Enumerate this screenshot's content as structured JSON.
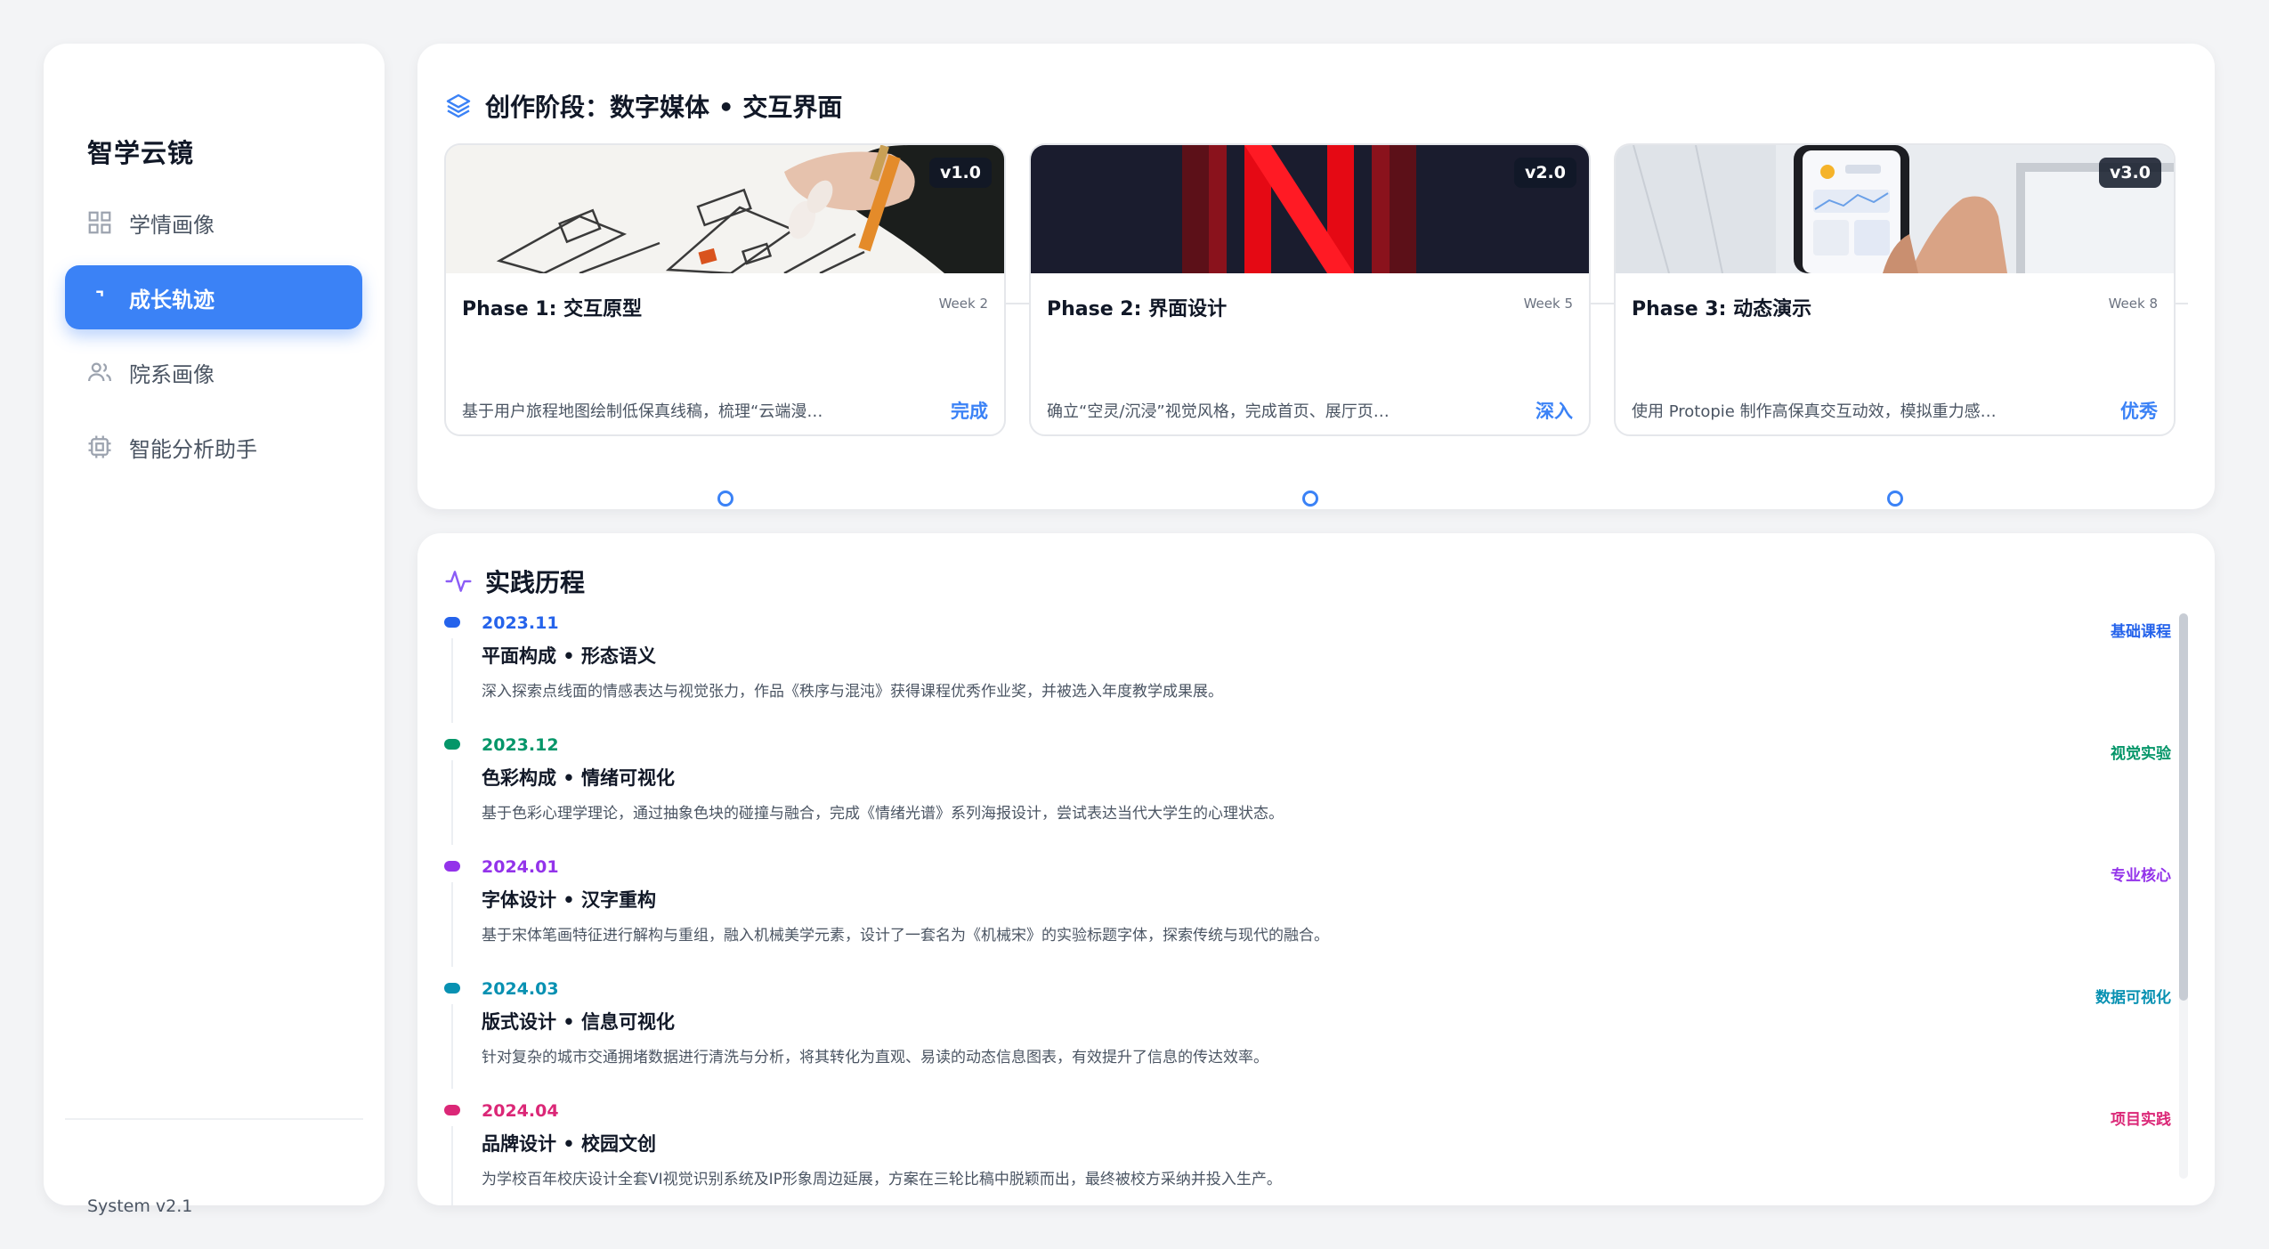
{
  "sidebar": {
    "brand": "智学云镜",
    "items": [
      {
        "label": "学情画像",
        "icon": "grid-icon",
        "active": false
      },
      {
        "label": "成长轨迹",
        "icon": "corner-icon",
        "active": true
      },
      {
        "label": "院系画像",
        "icon": "users-icon",
        "active": false
      },
      {
        "label": "智能分析助手",
        "icon": "chip-icon",
        "active": false
      }
    ],
    "version": "System v2.1"
  },
  "creation": {
    "title": "创作阶段：数字媒体 • 交互界面",
    "phases": [
      {
        "version": "v1.0",
        "name": "Phase 1: 交互原型",
        "week": "Week 2",
        "desc": "基于用户旅程地图绘制低保真线稿，梳理“云端漫…",
        "status": "完成"
      },
      {
        "version": "v2.0",
        "name": "Phase 2: 界面设计",
        "week": "Week 5",
        "desc": "确立“空灵/沉浸”视觉风格，完成首页、展厅页…",
        "status": "深入"
      },
      {
        "version": "v3.0",
        "name": "Phase 3: 动态演示",
        "week": "Week 8",
        "desc": "使用 Protopie 制作高保真交互动效，模拟重力感…",
        "status": "优秀"
      }
    ]
  },
  "practice": {
    "title": "实践历程",
    "events": [
      {
        "date": "2023.11",
        "title": "平面构成 • 形态语义",
        "desc": "深入探索点线面的情感表达与视觉张力，作品《秩序与混沌》获得课程优秀作业奖，并被选入年度教学成果展。",
        "tag": "基础课程",
        "color": "#2563eb"
      },
      {
        "date": "2023.12",
        "title": "色彩构成 • 情绪可视化",
        "desc": "基于色彩心理学理论，通过抽象色块的碰撞与融合，完成《情绪光谱》系列海报设计，尝试表达当代大学生的心理状态。",
        "tag": "视觉实验",
        "color": "#059669"
      },
      {
        "date": "2024.01",
        "title": "字体设计 • 汉字重构",
        "desc": "基于宋体笔画特征进行解构与重组，融入机械美学元素，设计了一套名为《机械宋》的实验标题字体，探索传统与现代的融合。",
        "tag": "专业核心",
        "color": "#9333ea"
      },
      {
        "date": "2024.03",
        "title": "版式设计 • 信息可视化",
        "desc": "针对复杂的城市交通拥堵数据进行清洗与分析，将其转化为直观、易读的动态信息图表，有效提升了信息的传达效率。",
        "tag": "数据可视化",
        "color": "#0891b2"
      },
      {
        "date": "2024.04",
        "title": "品牌设计 • 校园文创",
        "desc": "为学校百年校庆设计全套VI视觉识别系统及IP形象周边延展，方案在三轮比稿中脱颖而出，最终被校方采纳并投入生产。",
        "tag": "项目实践",
        "color": "#db2777"
      }
    ]
  },
  "colors": {
    "accent": "#3b82f6",
    "practiceIcon": "#8b5cf6"
  }
}
